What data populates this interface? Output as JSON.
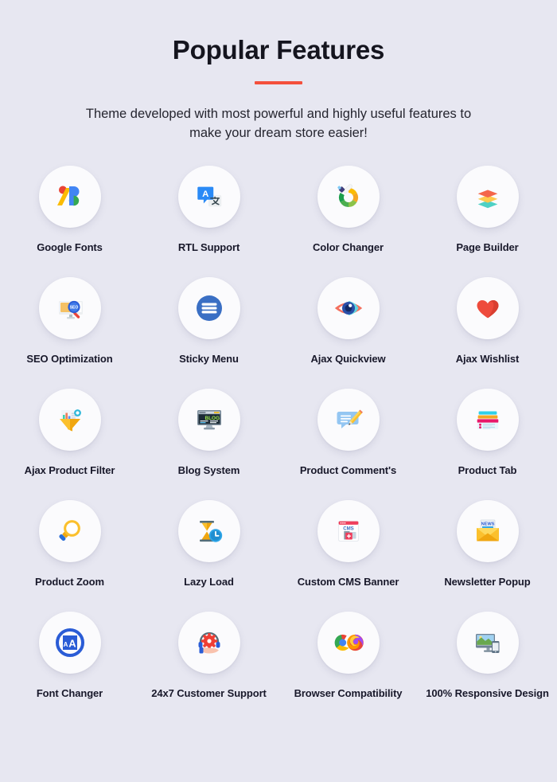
{
  "header": {
    "title": "Popular Features",
    "subtitle": "Theme developed with most powerful and highly useful features to make your dream store easier!",
    "accent_color": "#f4503c",
    "background_color": "#e7e7f1",
    "text_color": "#15151f"
  },
  "features": [
    {
      "label": "Google Fonts",
      "icon": "google-fonts-icon"
    },
    {
      "label": "RTL Support",
      "icon": "translate-icon"
    },
    {
      "label": "Color Changer",
      "icon": "color-wheel-eyedropper-icon"
    },
    {
      "label": "Page Builder",
      "icon": "layers-icon"
    },
    {
      "label": "SEO Optimization",
      "icon": "seo-monitor-magnifier-icon"
    },
    {
      "label": "Sticky Menu",
      "icon": "hamburger-menu-icon"
    },
    {
      "label": "Ajax Quickview",
      "icon": "eye-icon"
    },
    {
      "label": "Ajax Wishlist",
      "icon": "heart-icon"
    },
    {
      "label": "Ajax Product Filter",
      "icon": "funnel-chart-icon"
    },
    {
      "label": "Blog System",
      "icon": "blog-monitor-icon"
    },
    {
      "label": "Product Comment's",
      "icon": "comment-pencil-icon"
    },
    {
      "label": "Product Tab",
      "icon": "tab-panels-icon"
    },
    {
      "label": "Product Zoom",
      "icon": "magnifier-icon"
    },
    {
      "label": "Lazy Load",
      "icon": "hourglass-clock-icon"
    },
    {
      "label": "Custom CMS Banner",
      "icon": "cms-browser-icon"
    },
    {
      "label": "Newsletter Popup",
      "icon": "news-envelope-icon"
    },
    {
      "label": "Font Changer",
      "icon": "font-size-aa-icon"
    },
    {
      "label": "24x7 Customer Support",
      "icon": "headset-gear-hand-icon"
    },
    {
      "label": "Browser Compatibility",
      "icon": "chrome-firefox-icon"
    },
    {
      "label": "100% Responsive Design",
      "icon": "devices-responsive-icon"
    }
  ]
}
